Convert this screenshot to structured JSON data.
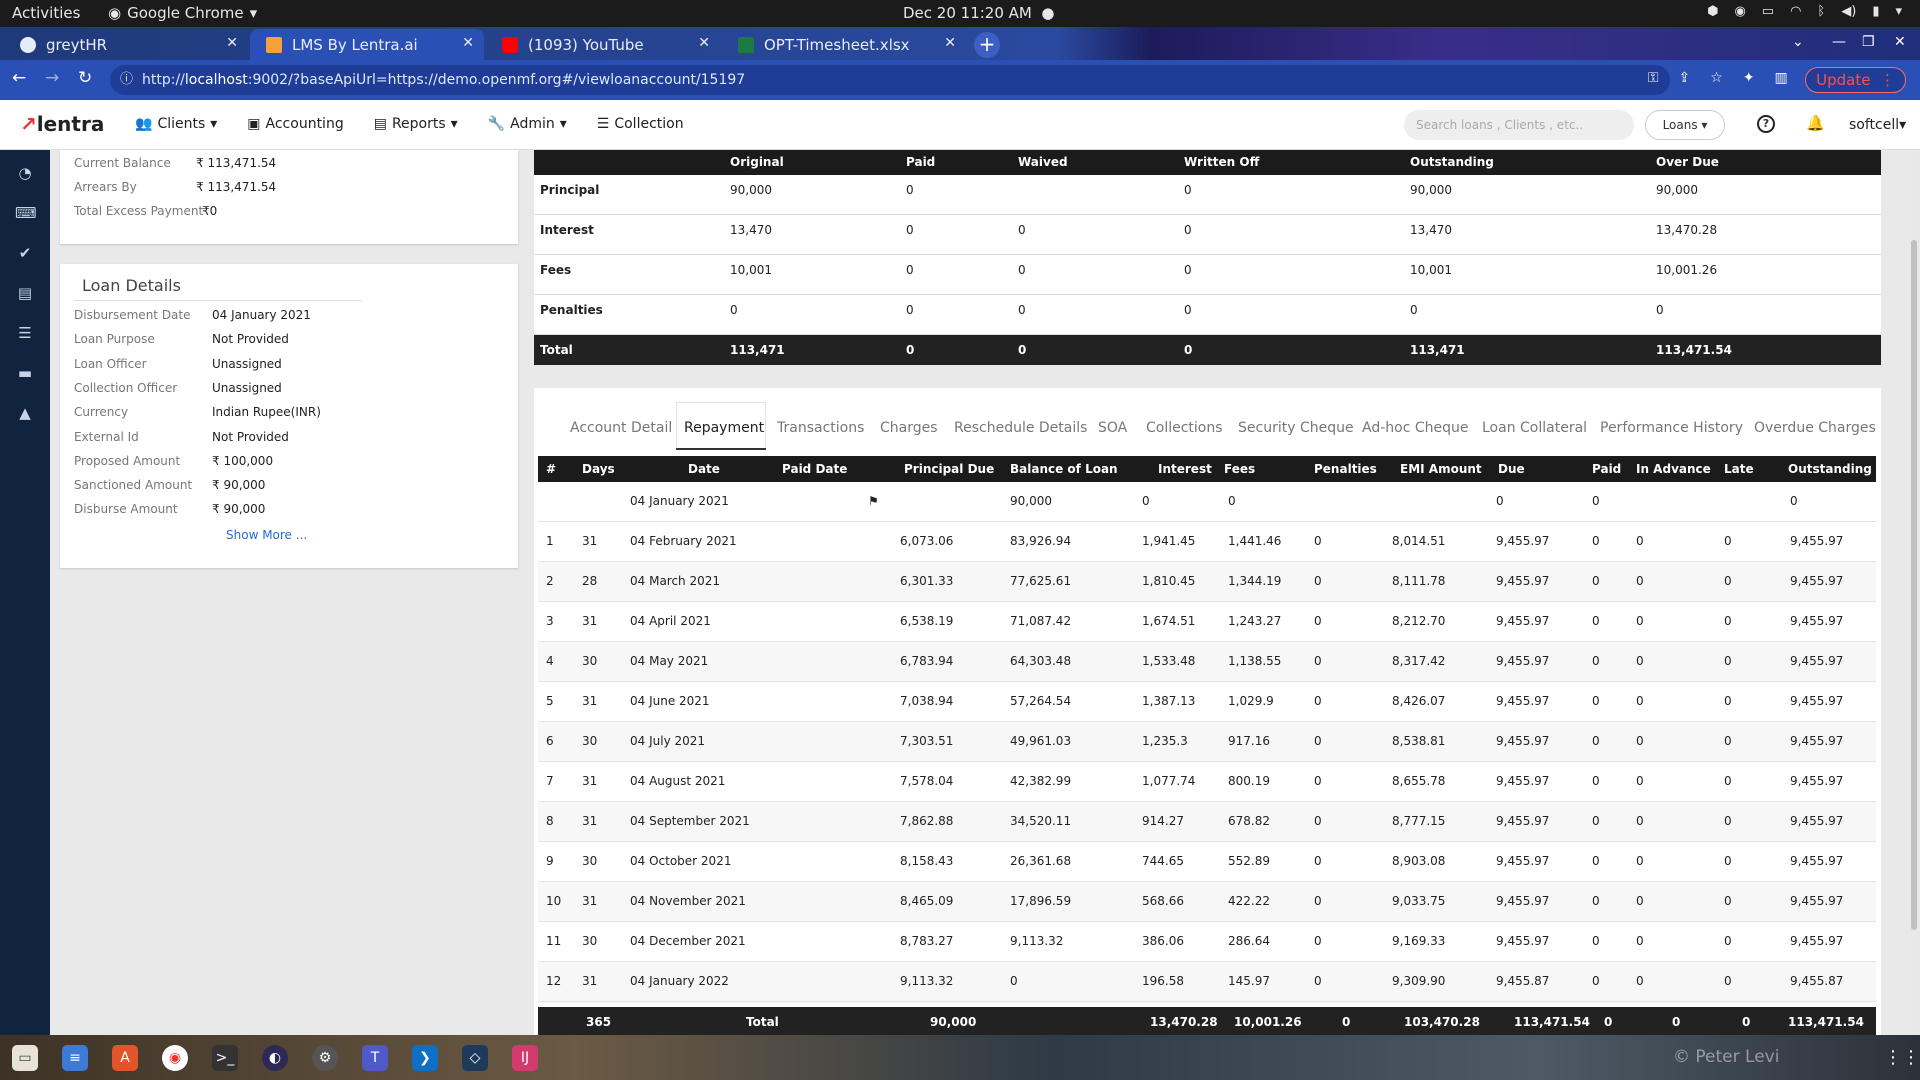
{
  "system": {
    "activities": "Activities",
    "app_name": "Google Chrome",
    "clock": "Dec 20  11:20 AM"
  },
  "browser": {
    "tabs": [
      {
        "label": "greytHR",
        "favicon_color": "#e6ecf7"
      },
      {
        "label": "LMS By Lentra.ai",
        "favicon_color": "#f4a23a"
      },
      {
        "label": "(1093) YouTube",
        "favicon_color": "#ff0000"
      },
      {
        "label": "OPT-Timesheet.xlsx",
        "favicon_color": "#1d7a44"
      }
    ],
    "url_prefix": "http://",
    "url_host": "localhost",
    "url_rest": ":9002/?baseApiUrl=https://demo.openmf.org#/viewloanaccount/15197",
    "update_label": "Update"
  },
  "app": {
    "logo": "lentra",
    "menu": [
      "Clients",
      "Accounting",
      "Reports",
      "Admin",
      "Collection"
    ],
    "search_placeholder": "Search loans , Clients , etc..",
    "loans_dropdown": "Loans",
    "user": "softcell"
  },
  "balance_card": {
    "items": [
      {
        "label": "Current Balance",
        "value": "₹ 113,471.54"
      },
      {
        "label": "Arrears By",
        "value": "₹ 113,471.54"
      },
      {
        "label": "Total Excess Payment",
        "value": "₹0"
      }
    ]
  },
  "loan_details": {
    "title": "Loan Details",
    "items": [
      {
        "label": "Disbursement Date",
        "value": "04 January 2021"
      },
      {
        "label": "Loan Purpose",
        "value": "Not Provided"
      },
      {
        "label": "Loan Officer",
        "value": "Unassigned"
      },
      {
        "label": "Collection Officer",
        "value": "Unassigned"
      },
      {
        "label": "Currency",
        "value": "Indian Rupee(INR)"
      },
      {
        "label": "External Id",
        "value": "Not Provided"
      },
      {
        "label": "Proposed Amount",
        "value": "₹ 100,000"
      },
      {
        "label": "Sanctioned Amount",
        "value": "₹ 90,000"
      },
      {
        "label": "Disburse Amount",
        "value": "₹ 90,000"
      }
    ],
    "show_more": "Show More ..."
  },
  "summary": {
    "headers": [
      "",
      "Original",
      "Paid",
      "Waived",
      "Written Off",
      "Outstanding",
      "Over Due"
    ],
    "rows": [
      [
        "Principal",
        "90,000",
        "0",
        "",
        "0",
        "90,000",
        "90,000"
      ],
      [
        "Interest",
        "13,470",
        "0",
        "0",
        "0",
        "13,470",
        "13,470.28"
      ],
      [
        "Fees",
        "10,001",
        "0",
        "0",
        "0",
        "10,001",
        "10,001.26"
      ],
      [
        "Penalties",
        "0",
        "0",
        "0",
        "0",
        "0",
        "0"
      ]
    ],
    "total": [
      "Total",
      "113,471",
      "0",
      "0",
      "0",
      "113,471",
      "113,471.54"
    ]
  },
  "detail_tabs": {
    "items": [
      "Account Detail",
      "Repayment",
      "Transactions",
      "Charges",
      "Reschedule Details",
      "SOA",
      "Collections",
      "Security Cheque",
      "Ad-hoc Cheque",
      "Loan Collateral",
      "Performance History",
      "Overdue Charges"
    ],
    "active": "Repayment"
  },
  "repayment": {
    "headers": [
      "#",
      "Days",
      "Date",
      "Paid Date",
      "Principal Due",
      "Balance of Loan",
      "Interest",
      "Fees",
      "Penalties",
      "EMI Amount",
      "Due",
      "Paid",
      "In Advance",
      "Late",
      "Outstanding"
    ],
    "disbursement_row": [
      "",
      "",
      "04 January 2021",
      "",
      "",
      "90,000",
      "0",
      "0",
      "",
      "",
      "0",
      "0",
      "",
      "",
      "0"
    ],
    "rows": [
      [
        "1",
        "31",
        "04 February 2021",
        "",
        "6,073.06",
        "83,926.94",
        "1,941.45",
        "1,441.46",
        "0",
        "8,014.51",
        "9,455.97",
        "0",
        "0",
        "0",
        "9,455.97"
      ],
      [
        "2",
        "28",
        "04 March 2021",
        "",
        "6,301.33",
        "77,625.61",
        "1,810.45",
        "1,344.19",
        "0",
        "8,111.78",
        "9,455.97",
        "0",
        "0",
        "0",
        "9,455.97"
      ],
      [
        "3",
        "31",
        "04 April 2021",
        "",
        "6,538.19",
        "71,087.42",
        "1,674.51",
        "1,243.27",
        "0",
        "8,212.70",
        "9,455.97",
        "0",
        "0",
        "0",
        "9,455.97"
      ],
      [
        "4",
        "30",
        "04 May 2021",
        "",
        "6,783.94",
        "64,303.48",
        "1,533.48",
        "1,138.55",
        "0",
        "8,317.42",
        "9,455.97",
        "0",
        "0",
        "0",
        "9,455.97"
      ],
      [
        "5",
        "31",
        "04 June 2021",
        "",
        "7,038.94",
        "57,264.54",
        "1,387.13",
        "1,029.9",
        "0",
        "8,426.07",
        "9,455.97",
        "0",
        "0",
        "0",
        "9,455.97"
      ],
      [
        "6",
        "30",
        "04 July 2021",
        "",
        "7,303.51",
        "49,961.03",
        "1,235.3",
        "917.16",
        "0",
        "8,538.81",
        "9,455.97",
        "0",
        "0",
        "0",
        "9,455.97"
      ],
      [
        "7",
        "31",
        "04 August 2021",
        "",
        "7,578.04",
        "42,382.99",
        "1,077.74",
        "800.19",
        "0",
        "8,655.78",
        "9,455.97",
        "0",
        "0",
        "0",
        "9,455.97"
      ],
      [
        "8",
        "31",
        "04 September 2021",
        "",
        "7,862.88",
        "34,520.11",
        "914.27",
        "678.82",
        "0",
        "8,777.15",
        "9,455.97",
        "0",
        "0",
        "0",
        "9,455.97"
      ],
      [
        "9",
        "30",
        "04 October 2021",
        "",
        "8,158.43",
        "26,361.68",
        "744.65",
        "552.89",
        "0",
        "8,903.08",
        "9,455.97",
        "0",
        "0",
        "0",
        "9,455.97"
      ],
      [
        "10",
        "31",
        "04 November 2021",
        "",
        "8,465.09",
        "17,896.59",
        "568.66",
        "422.22",
        "0",
        "9,033.75",
        "9,455.97",
        "0",
        "0",
        "0",
        "9,455.97"
      ],
      [
        "11",
        "30",
        "04 December 2021",
        "",
        "8,783.27",
        "9,113.32",
        "386.06",
        "286.64",
        "0",
        "9,169.33",
        "9,455.97",
        "0",
        "0",
        "0",
        "9,455.97"
      ],
      [
        "12",
        "31",
        "04 January 2022",
        "",
        "9,113.32",
        "0",
        "196.58",
        "145.97",
        "0",
        "9,309.90",
        "9,455.87",
        "0",
        "0",
        "0",
        "9,455.87"
      ]
    ],
    "footer": [
      "",
      "365",
      "Total",
      "",
      "90,000",
      "",
      "13,470.28",
      "10,001.26",
      "0",
      "103,470.28",
      "113,471.54",
      "0",
      "0",
      "0",
      "113,471.54"
    ]
  },
  "dock": {
    "credit": "© Peter Levi"
  }
}
